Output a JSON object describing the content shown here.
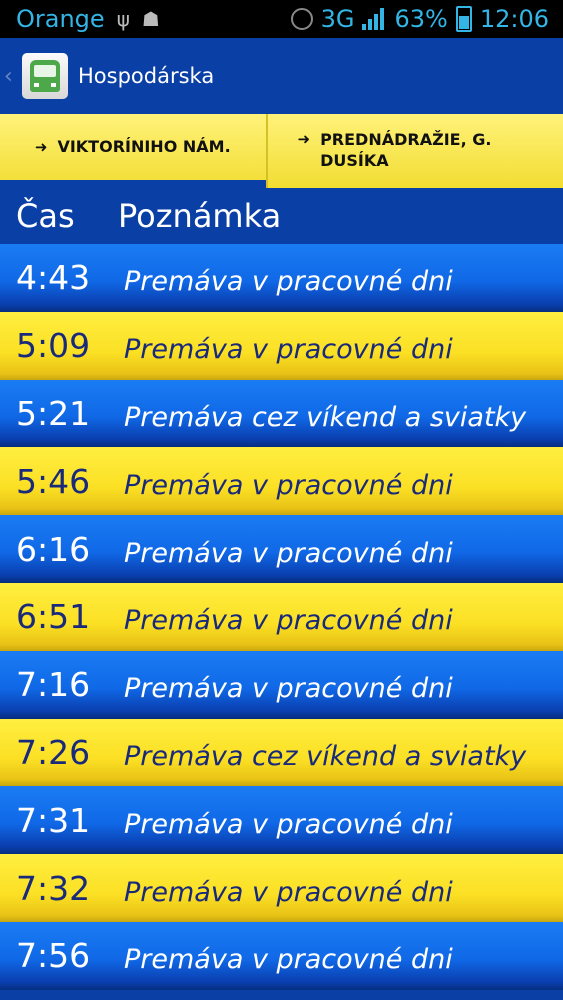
{
  "status_bar": {
    "carrier": "Orange",
    "usb_icon": "usb-icon",
    "android_icon": "android-icon",
    "network": "3G",
    "battery_pct": "63%",
    "time": "12:06"
  },
  "action_bar": {
    "app_icon": "bus-icon",
    "title": "Hospodárska"
  },
  "tabs": [
    {
      "label": "VIKTORÍNIHO NÁM.",
      "active": true
    },
    {
      "label": "PREDNÁDRAŽIE, G. DUSÍKA",
      "active": false
    }
  ],
  "columns": {
    "time": "Čas",
    "note": "Poznámka"
  },
  "rows": [
    {
      "time": "4:43",
      "note": "Premáva v pracovné dni"
    },
    {
      "time": "5:09",
      "note": "Premáva v pracovné dni"
    },
    {
      "time": "5:21",
      "note": "Premáva cez víkend a sviatky"
    },
    {
      "time": "5:46",
      "note": "Premáva v pracovné dni"
    },
    {
      "time": "6:16",
      "note": "Premáva v pracovné dni"
    },
    {
      "time": "6:51",
      "note": "Premáva v pracovné dni"
    },
    {
      "time": "7:16",
      "note": "Premáva v pracovné dni"
    },
    {
      "time": "7:26",
      "note": "Premáva cez víkend a sviatky"
    },
    {
      "time": "7:31",
      "note": "Premáva v pracovné dni"
    },
    {
      "time": "7:32",
      "note": "Premáva v pracovné dni"
    },
    {
      "time": "7:56",
      "note": "Premáva v pracovné dni"
    }
  ],
  "colors": {
    "blue": "#0a3fa6",
    "yellow": "#fbe024",
    "status_accent": "#33b5e5"
  }
}
